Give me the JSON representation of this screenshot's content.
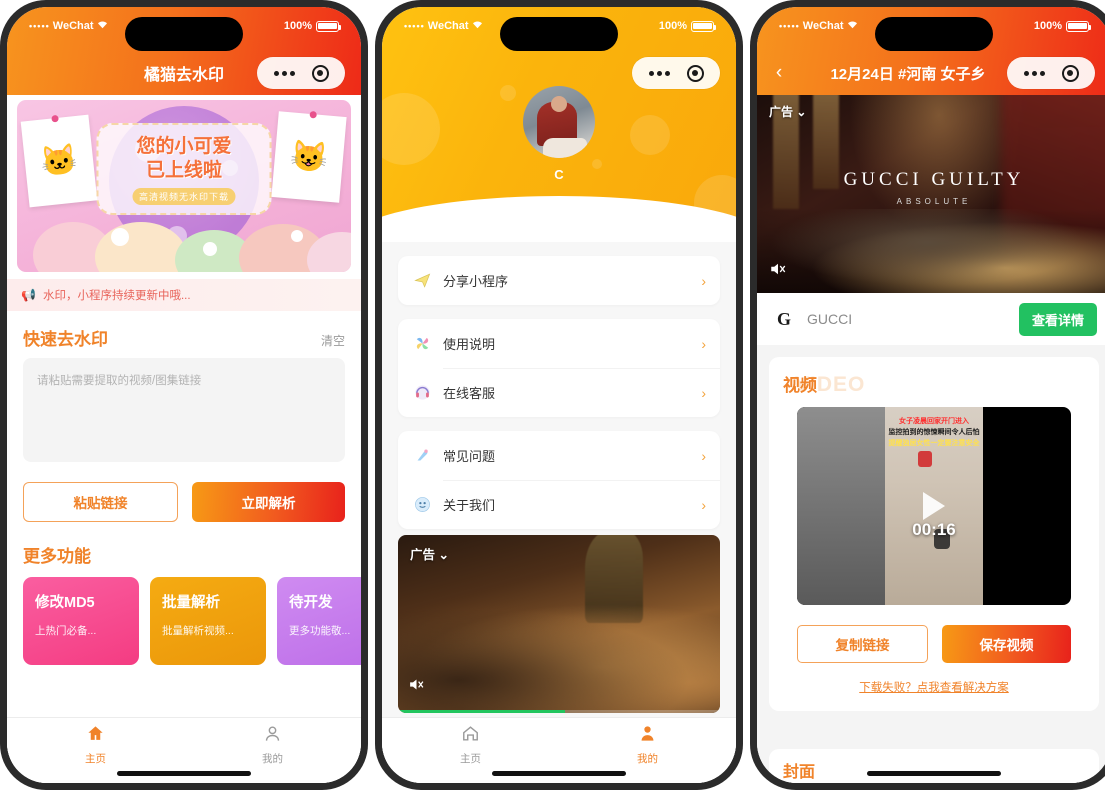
{
  "status_bar": {
    "signal_dots": "•••••",
    "carrier": "WeChat",
    "wifi_icon": "wifi-icon",
    "battery_text": "100%"
  },
  "capsule": {
    "more_icon": "more-dots-icon",
    "close_icon": "target-close-icon"
  },
  "phone1": {
    "title": "橘猫去水印",
    "banner": {
      "line1": "您的小可爱",
      "line2": "已上线啦",
      "sub": "高清视频无水印下载",
      "left_cat_icon": "orange-cat-photo",
      "right_cat_icon": "yellow-cat-photo"
    },
    "notice": {
      "icon": "megaphone-icon",
      "text": "水印，小程序持续更新中哦..."
    },
    "section": {
      "title": "快速去水印",
      "action": "清空"
    },
    "input": {
      "placeholder": "请粘贴需要提取的视频/图集链接",
      "value": ""
    },
    "buttons": {
      "paste": "粘贴链接",
      "parse": "立即解析"
    },
    "more": {
      "title": "更多功能"
    },
    "cards": [
      {
        "title": "修改MD5",
        "desc": "上热门必备...",
        "color": "#f43c82"
      },
      {
        "title": "批量解析",
        "desc": "批量解析视频...",
        "color": "#eb970a"
      },
      {
        "title": "待开发",
        "desc": "更多功能敬...",
        "color": "#bd6ee8"
      }
    ],
    "tabs": [
      {
        "label": "主页",
        "icon": "home-icon",
        "active": true
      },
      {
        "label": "我的",
        "icon": "user-icon",
        "active": false
      }
    ]
  },
  "phone2": {
    "avatar_icon": "user-avatar",
    "username": "C",
    "groups": [
      {
        "items": [
          {
            "label": "分享小程序",
            "icon": "share-paperplane-icon"
          }
        ]
      },
      {
        "items": [
          {
            "label": "使用说明",
            "icon": "pinwheel-icon"
          },
          {
            "label": "在线客服",
            "icon": "headset-icon"
          }
        ]
      },
      {
        "items": [
          {
            "label": "常见问题",
            "icon": "question-bird-icon"
          },
          {
            "label": "关于我们",
            "icon": "info-smiley-icon"
          }
        ]
      }
    ],
    "chevron": "›",
    "ad": {
      "label": "广告",
      "dropdown_icon": "chevron-down-icon",
      "mute_icon": "muted-speaker-icon"
    },
    "tabs": [
      {
        "label": "主页",
        "icon": "home-icon",
        "active": false
      },
      {
        "label": "我的",
        "icon": "user-icon",
        "active": true
      }
    ]
  },
  "phone3": {
    "back_icon": "back-chevron-icon",
    "title": "12月24日 #河南 女子乡",
    "ad": {
      "label": "广告",
      "dropdown_icon": "chevron-down-icon",
      "headline": "GUCCI GUILTY",
      "subhead": "ABSOLUTE",
      "mute_icon": "muted-speaker-icon",
      "brand_logo_icon": "gucci-logo-icon",
      "brand_name": "GUCCI",
      "cta": "查看详情"
    },
    "video": {
      "section_title": "视频",
      "section_ghost": "VIDEO",
      "duration": "00:16",
      "play_icon": "play-icon",
      "overlay_line1": "女子凌晨回家开门进入",
      "overlay_line2": "监控拍到的惊悚瞬间令人后怕",
      "overlay_line3": "提醒独居女性一定要注意安全",
      "copy_button": "复制链接",
      "save_button": "保存视频",
      "help_link": "下载失败？点我查看解决方案"
    },
    "cover": {
      "section_title": "封面"
    }
  }
}
